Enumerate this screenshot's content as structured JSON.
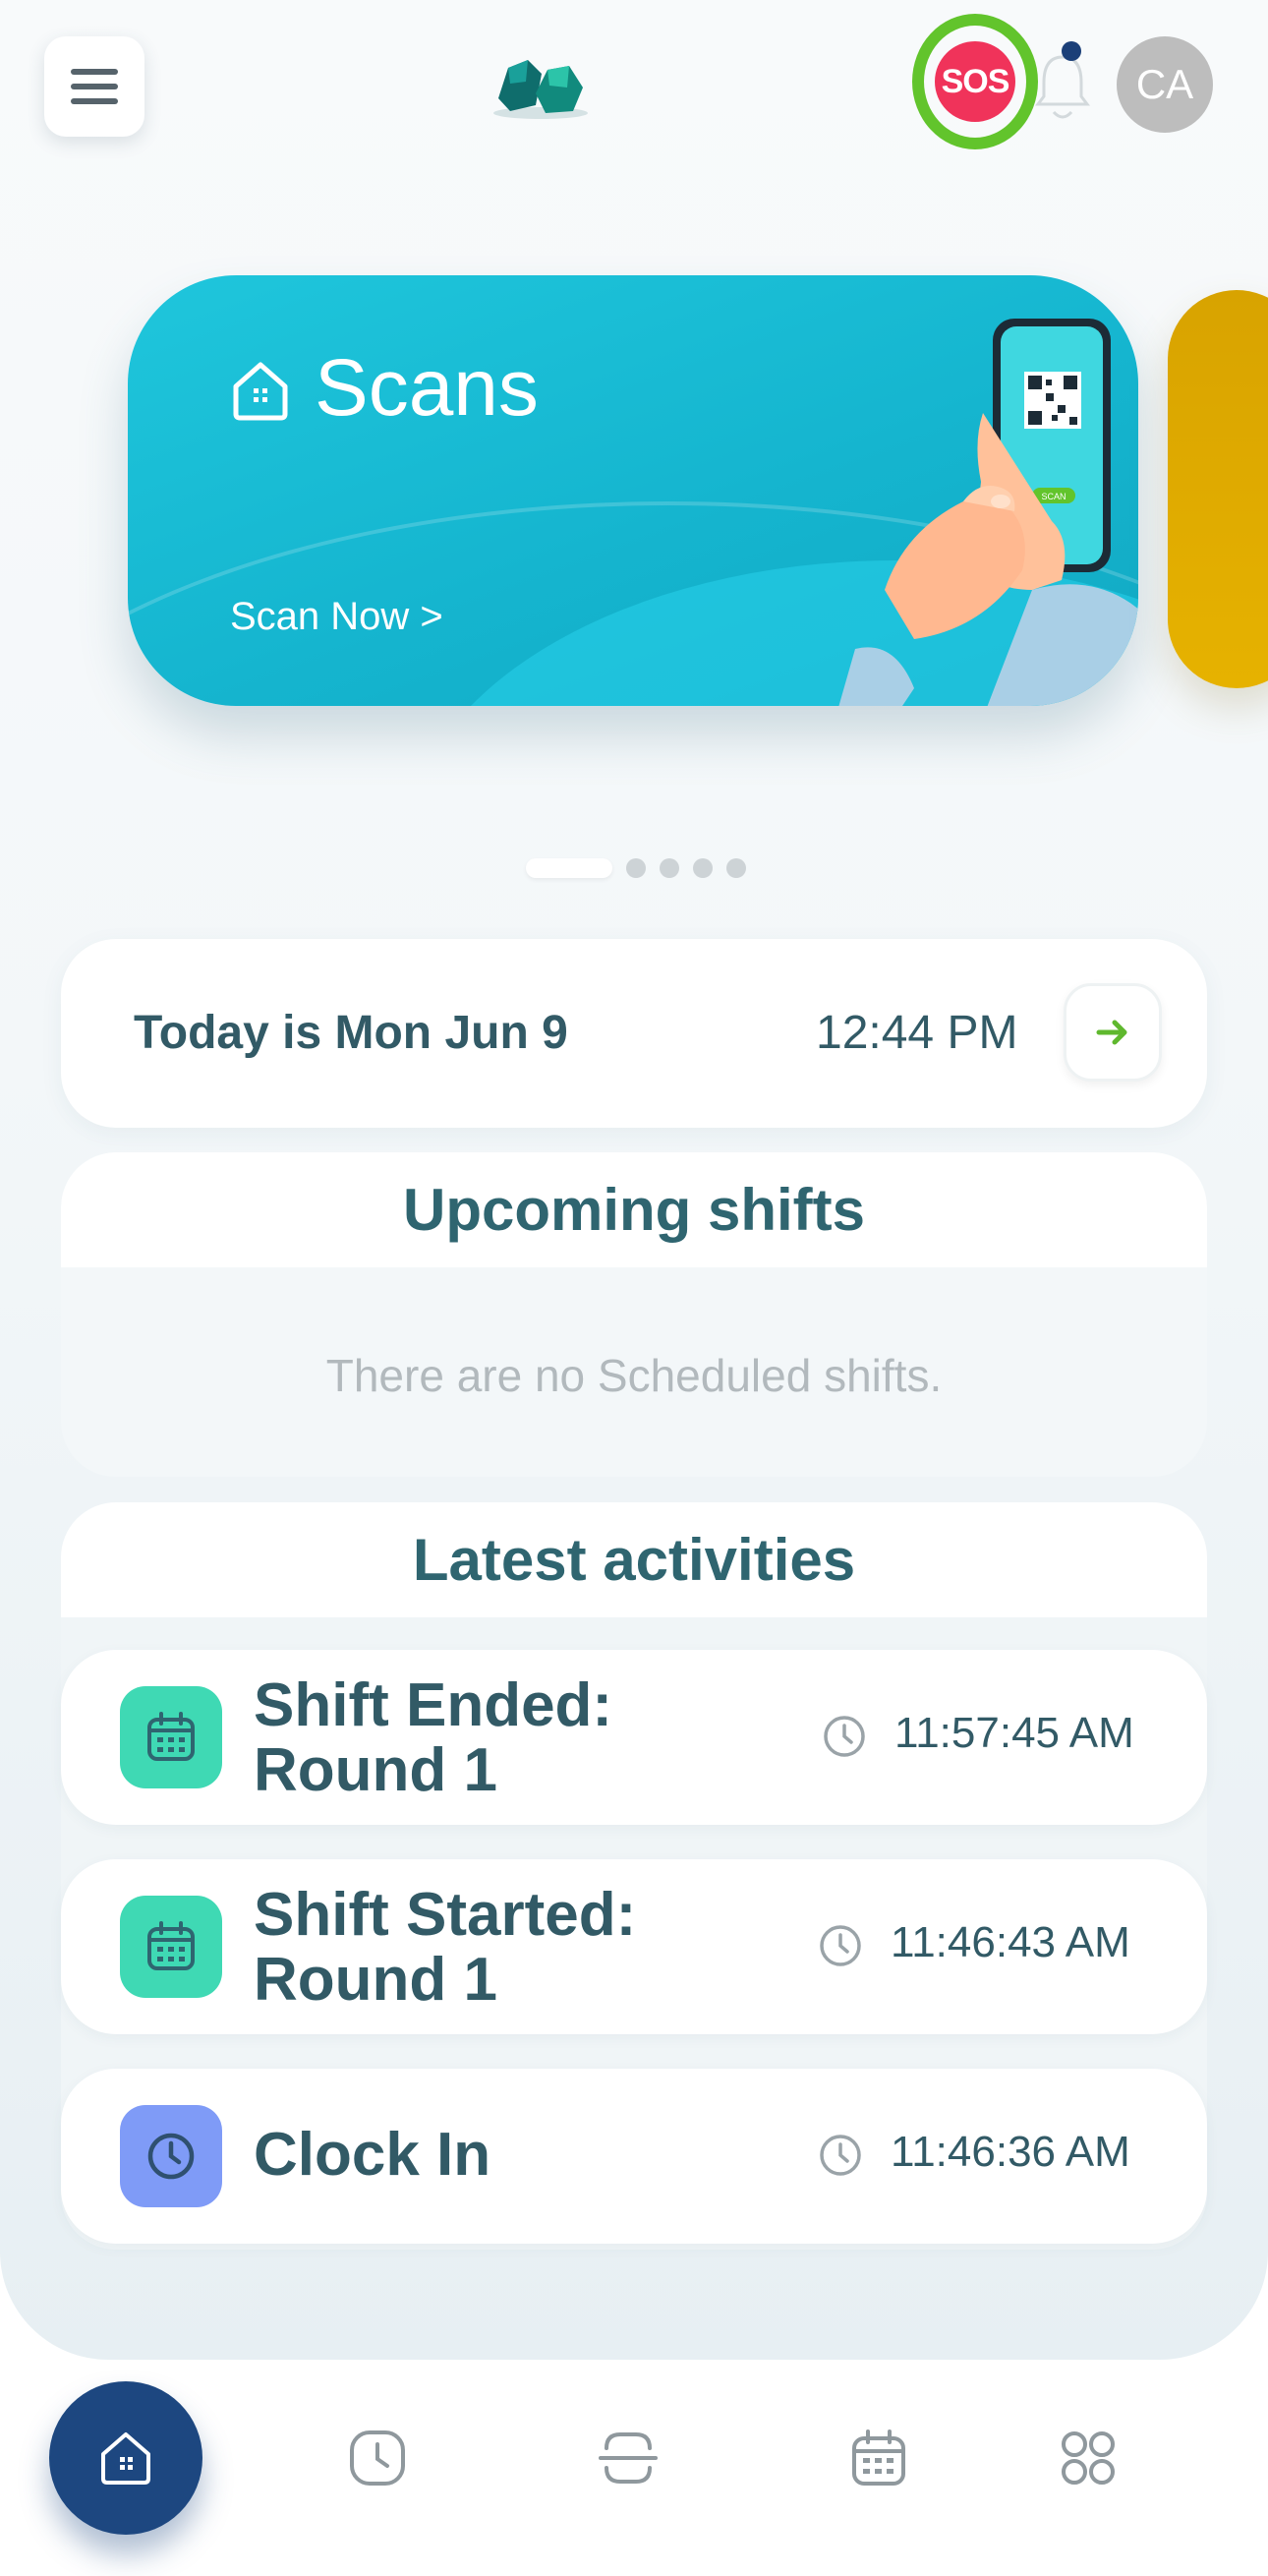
{
  "header": {
    "sos_label": "SOS",
    "avatar_initials": "CA"
  },
  "banner": {
    "title": "Scans",
    "cta": "Scan Now >",
    "phone_button_text": "SCAN",
    "page_count": 5,
    "active_page": 1
  },
  "today": {
    "date_text": "Today is Mon Jun 9",
    "time_text": "12:44 PM"
  },
  "upcoming_shifts": {
    "title": "Upcoming shifts",
    "empty_message": "There are no Scheduled shifts."
  },
  "latest_activities": {
    "title": "Latest activities",
    "items": [
      {
        "title_line1": "Shift Ended:",
        "title_line2": "Round 1",
        "time": "11:57:45 AM",
        "icon": "calendar-icon",
        "icon_color": "#3fd9b4"
      },
      {
        "title_line1": "Shift Started:",
        "title_line2": "Round 1",
        "time": "11:46:43 AM",
        "icon": "calendar-icon",
        "icon_color": "#3fd9b4"
      },
      {
        "title_line1": "Clock In",
        "title_line2": "",
        "time": "11:46:36 AM",
        "icon": "clock-icon",
        "icon_color": "#7f9bf7"
      }
    ]
  },
  "bottom_nav": [
    "home-icon",
    "clock-icon",
    "scan-icon",
    "calendar-icon",
    "grid-icon"
  ],
  "colors": {
    "accent_teal": "#2f6570",
    "banner_cyan": "#1fc6dc",
    "sos_red": "#f0335a",
    "sos_ring_green": "#62c42c",
    "nav_active": "#1d4780",
    "arrow_green": "#5fb82e"
  }
}
